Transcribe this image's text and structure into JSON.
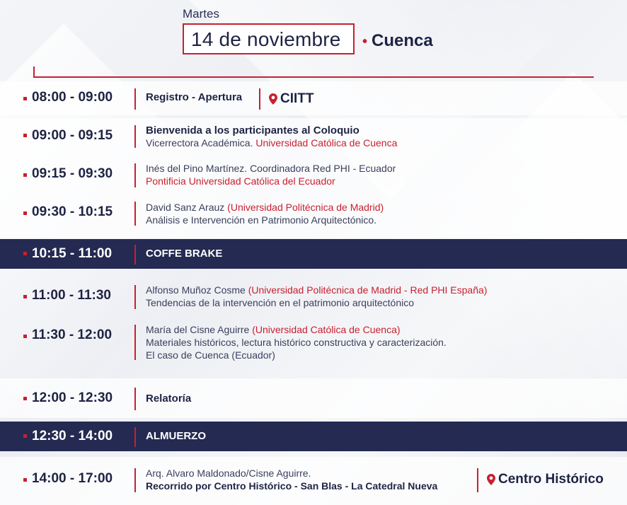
{
  "header": {
    "day": "Martes",
    "date": "14 de noviembre",
    "city": "Cuenca"
  },
  "schedule": [
    {
      "time": "08:00 - 09:00",
      "title": "Registro - Apertura",
      "location": "CIITT"
    },
    {
      "time": "09:00 - 09:15",
      "title": "Bienvenida a los participantes al Coloquio",
      "line1_plain": "Vicerrectora Académica. ",
      "line1_red": "Universidad Católica de Cuenca"
    },
    {
      "time": "09:15 - 09:30",
      "line1_plain": "Inés del Pino Martínez. Coordinadora Red PHI - Ecuador",
      "line2_red": "Pontificia Universidad Católica del Ecuador"
    },
    {
      "time": "09:30 - 10:15",
      "line1_plain": "David Sanz Arauz ",
      "line1_red": "(Universidad Politécnica de Madrid)",
      "line2_plain": "Análisis e Intervención en Patrimonio Arquitectónico."
    },
    {
      "time": "10:15 - 11:00",
      "title": "COFFE BRAKE"
    },
    {
      "time": "11:00 - 11:30",
      "line1_plain": "Alfonso Muñoz Cosme ",
      "line1_red": "(Universidad Politécnica de Madrid - Red PHI España)",
      "line2_plain": "Tendencias de la intervención en el patrimonio arquitectónico"
    },
    {
      "time": "11:30 - 12:00",
      "line1_plain": "María del Cisne Aguirre ",
      "line1_red": "(Universidad Católica de Cuenca)",
      "line2_plain": "Materiales históricos, lectura histórico constructiva y caracterización.",
      "line3_plain": "El caso de Cuenca (Ecuador)"
    },
    {
      "time": "12:00 - 12:30",
      "title": "Relatoría"
    },
    {
      "time": "12:30 - 14:00",
      "title": "ALMUERZO"
    },
    {
      "time": "14:00 - 17:00",
      "line1_plain": "Arq. Alvaro Maldonado/Cisne Aguirre.",
      "line2_bold": "Recorrido por Centro Histórico - San Blas - La Catedral Nueva",
      "location": "Centro Histórico"
    }
  ],
  "colors": {
    "accent": "#c8202f",
    "navy": "#252a52"
  },
  "icons": {
    "location": "map-pin-icon"
  }
}
